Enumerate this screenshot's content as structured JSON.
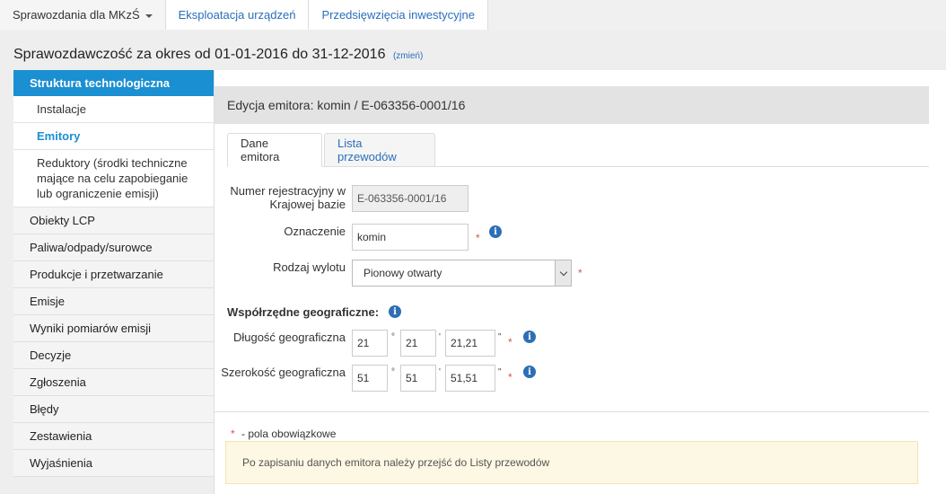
{
  "topnav": {
    "items": [
      "Sprawozdania dla MKzŚ",
      "Eksploatacja urządzeń",
      "Przedsięwzięcia inwestycyjne"
    ]
  },
  "period": {
    "text": "Sprawozdawczość za okres od 01-01-2016 do 31-12-2016",
    "change": "(zmień)"
  },
  "sidebar": {
    "active": "Struktura technologiczna",
    "subitems": [
      "Instalacje",
      "Emitory",
      "Reduktory (środki techniczne mające na celu zapobieganie lub ograniczenie emisji)"
    ],
    "items": [
      "Obiekty LCP",
      "Paliwa/odpady/surowce",
      "Produkcje i przetwarzanie",
      "Emisje",
      "Wyniki pomiarów emisji",
      "Decyzje",
      "Zgłoszenia",
      "Błędy",
      "Zestawienia",
      "Wyjaśnienia"
    ]
  },
  "panel": {
    "title": "Edycja emitora: komin / E-063356-0001/16",
    "tabs": [
      "Dane emitora",
      "Lista przewodów"
    ]
  },
  "form": {
    "reg_label": "Numer rejestracyjny w Krajowej bazie",
    "reg_value": "E-063356-0001/16",
    "ozn_label": "Oznaczenie",
    "ozn_value": "komin",
    "wylot_label": "Rodzaj wylotu",
    "wylot_value": "Pionowy otwarty",
    "geo_title": "Współrzędne geograficzne:",
    "lon_label": "Długość geograficzna",
    "lon": [
      "21",
      "21",
      "21,21"
    ],
    "lat_label": "Szerokość geograficzna",
    "lat": [
      "51",
      "51",
      "51,51"
    ],
    "deg": "°",
    "min": "'",
    "sec": "\"",
    "req": "*",
    "info": "i"
  },
  "footer": {
    "required_note": "- pola obowiązkowe",
    "alert": "Po zapisaniu danych emitora należy przejść do Listy przewodów"
  },
  "colors": {
    "accent": "#1a8fd1",
    "link": "#2a6ebb",
    "required": "#d9534f",
    "alert_bg": "#fcf8e3"
  }
}
